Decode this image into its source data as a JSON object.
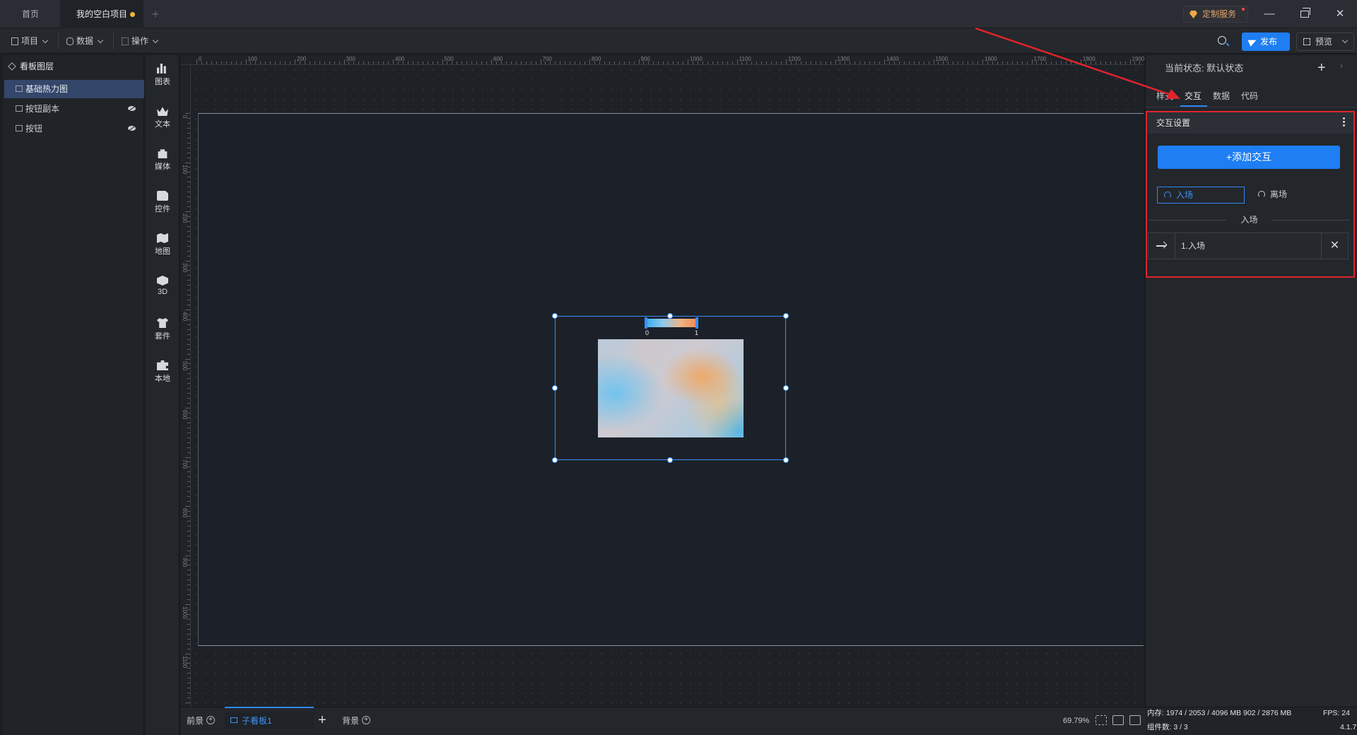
{
  "tabs": {
    "home": "首页",
    "project": "我的空白项目"
  },
  "titlebar": {
    "custom_service": "定制服务"
  },
  "toolbar": {
    "menus": [
      "项目",
      "数据",
      "操作"
    ],
    "publish": "发布",
    "preview": "预览"
  },
  "layers": {
    "title": "看板图层",
    "items": [
      {
        "label": "基础热力图",
        "selected": true
      },
      {
        "label": "按钮副本",
        "hidden": true
      },
      {
        "label": "按钮",
        "hidden": true
      }
    ]
  },
  "components": [
    "图表",
    "文本",
    "媒体",
    "控件",
    "地图",
    "3D",
    "套件",
    "本地"
  ],
  "ruler": {
    "h_labels": [
      "0",
      "100",
      "200",
      "300",
      "400",
      "500",
      "600",
      "700",
      "800",
      "900",
      "1000",
      "1100",
      "1200",
      "1300",
      "1400",
      "1500",
      "1600",
      "1700",
      "1800",
      "1900"
    ],
    "v_labels": [
      "0",
      "100",
      "200",
      "300",
      "400",
      "500",
      "600",
      "700",
      "800",
      "900",
      "1000",
      "1100",
      "1200"
    ]
  },
  "heatmap": {
    "legend_min": "0",
    "legend_max": "1"
  },
  "right_panel": {
    "state_label": "当前状态:  默认状态",
    "tabs": [
      "样式",
      "交互",
      "数据",
      "代码"
    ],
    "active_tab": "交互",
    "section_title": "交互设置",
    "add_button": "+添加交互",
    "triggers": [
      "入场",
      "离场"
    ],
    "active_trigger": "入场",
    "divider_label": "入场",
    "actions": [
      "1.入场"
    ]
  },
  "bottom": {
    "front": "前景",
    "sub_board": "子看板1",
    "background": "背景",
    "zoom": "69.79%"
  },
  "status": {
    "memory": "内存: 1974 / 2053 / 4096 MB  902 / 2876 MB",
    "fps": "FPS: 24",
    "component_count": "组件数: 3 / 3",
    "version": "4.1.7"
  },
  "colors": {
    "accent": "#1e7ef2",
    "highlight_box": "#e0242c",
    "selected_layer": "#34476a"
  }
}
